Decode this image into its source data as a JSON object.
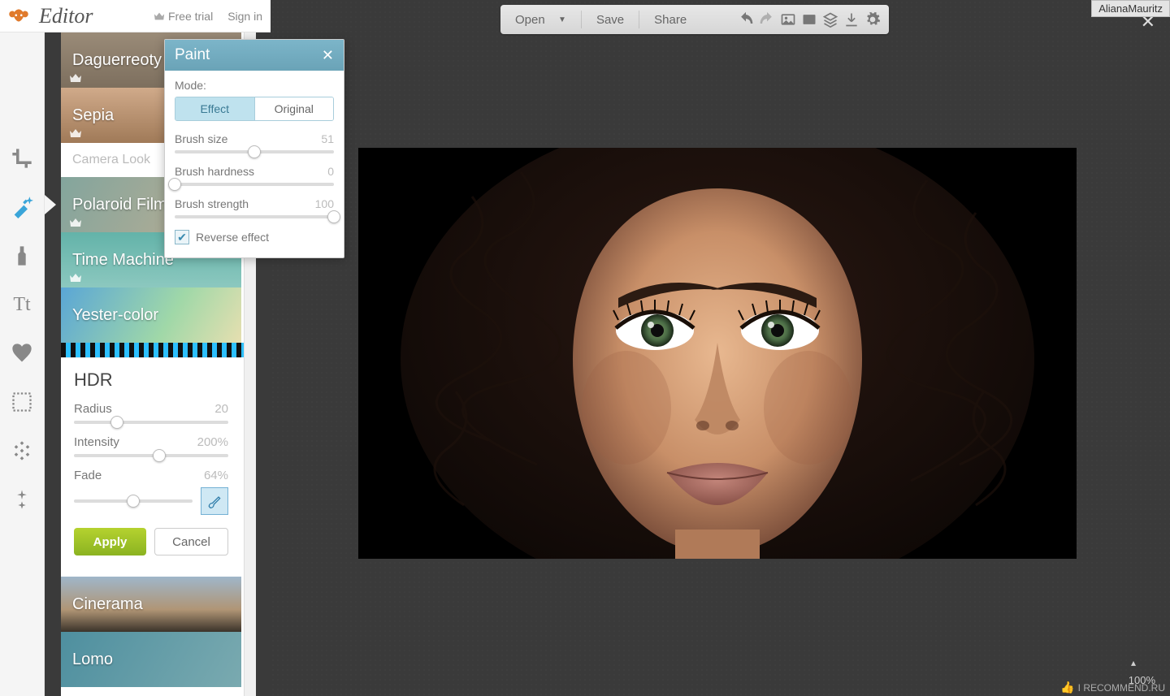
{
  "app": {
    "title": "Editor"
  },
  "header": {
    "free_trial": "Free trial",
    "sign_in": "Sign in"
  },
  "effects": {
    "items": [
      "Daguerreoty",
      "Sepia",
      "Camera Look",
      "Polaroid Film",
      "Time Machine",
      "Yester-color",
      "HDR",
      "Cinerama",
      "Lomo"
    ]
  },
  "hdr": {
    "title": "HDR",
    "radius_label": "Radius",
    "radius_value": "20",
    "radius_pct": 28,
    "intensity_label": "Intensity",
    "intensity_value": "200%",
    "intensity_pct": 55,
    "fade_label": "Fade",
    "fade_value": "64%",
    "fade_pct": 50,
    "apply": "Apply",
    "cancel": "Cancel"
  },
  "paint": {
    "title": "Paint",
    "mode_label": "Mode:",
    "mode_effect": "Effect",
    "mode_original": "Original",
    "brush_size_label": "Brush size",
    "brush_size_value": "51",
    "brush_size_pct": 50,
    "brush_hard_label": "Brush hardness",
    "brush_hard_value": "0",
    "brush_hard_pct": 0,
    "brush_str_label": "Brush strength",
    "brush_str_value": "100",
    "brush_str_pct": 100,
    "reverse_label": "Reverse effect",
    "reverse_checked": true
  },
  "canvas_toolbar": {
    "open": "Open",
    "save": "Save",
    "share": "Share"
  },
  "zoom": "100%",
  "watermark_user": "AlianaMauritz",
  "watermark_site": "I RECOMMEND.RU"
}
